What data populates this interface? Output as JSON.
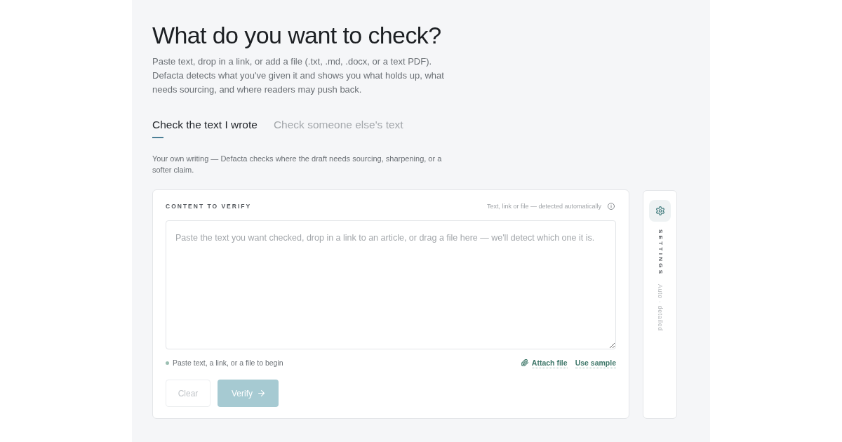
{
  "header": {
    "title": "What do you want to check?",
    "description": "Paste text, drop in a link, or add a file (.txt, .md, .docx, or a text PDF). Defacta detects what you've given it and shows you what holds up, what needs sourcing, and where readers may push back."
  },
  "tabs": [
    {
      "label": "Check the text I wrote",
      "selected": true
    },
    {
      "label": "Check someone else's text",
      "selected": false
    }
  ],
  "tab_hint": "Your own writing — Defacta checks where the draft needs sourcing, sharpening, or a softer claim.",
  "content_card": {
    "label": "CONTENT TO VERIFY",
    "detection_note": "Text, link or file — detected automatically",
    "input": {
      "placeholder": "Paste the text you want checked, drop in a link to an article, or drag a file here — we'll detect which one it is."
    },
    "status": "Paste text, a link, or a file to begin",
    "links": [
      {
        "label": "Attach file",
        "kind": "attach"
      },
      {
        "label": "Use sample",
        "kind": "plain"
      }
    ],
    "buttons": [
      {
        "label": "Clear",
        "kind": "secondary",
        "disabled": true
      },
      {
        "label": "Verify",
        "kind": "primary",
        "disabled": true
      }
    ]
  },
  "settings": {
    "label": "SETTINGS",
    "summary": "Auto · detailed"
  }
}
